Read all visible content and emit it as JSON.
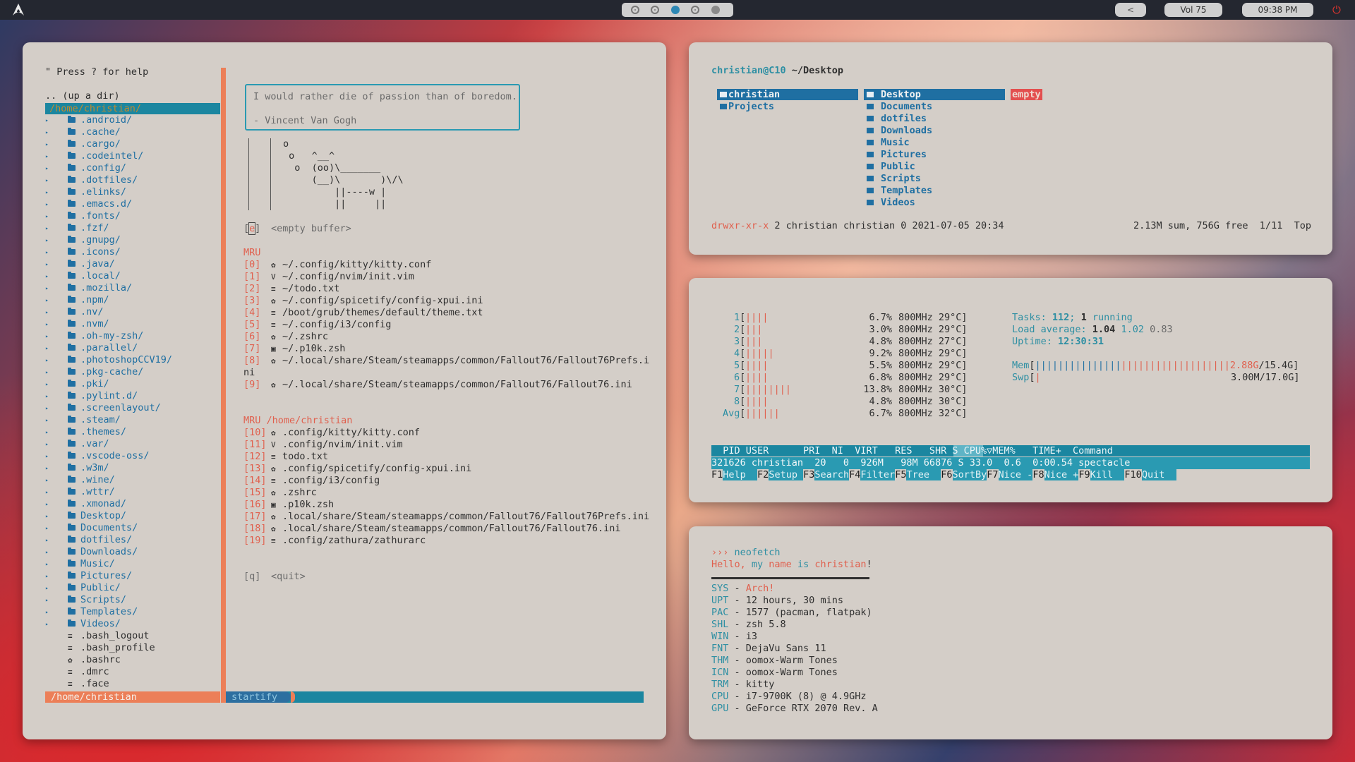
{
  "topbar": {
    "back": "<",
    "volume": "Vol 75",
    "clock": "09:38 PM",
    "workspaces": 5,
    "active_workspace": 3
  },
  "nvim": {
    "help": "\" Press ? for help",
    "up_dir": ".. (up a dir)",
    "cwd_selected": "/home/christian/",
    "tree_dirs": [
      ".android/",
      ".cache/",
      ".cargo/",
      ".codeintel/",
      ".config/",
      ".dotfiles/",
      ".elinks/",
      ".emacs.d/",
      ".fonts/",
      ".fzf/",
      ".gnupg/",
      ".icons/",
      ".java/",
      ".local/",
      ".mozilla/",
      ".npm/",
      ".nv/",
      ".nvm/",
      ".oh-my-zsh/",
      ".parallel/",
      ".photoshopCCV19/",
      ".pkg-cache/",
      ".pki/",
      ".pylint.d/",
      ".screenlayout/",
      ".steam/",
      ".themes/",
      ".var/",
      ".vscode-oss/",
      ".w3m/",
      ".wine/",
      ".wttr/",
      ".xmonad/",
      "Desktop/",
      "Documents/",
      "dotfiles/",
      "Downloads/",
      "Music/",
      "Pictures/",
      "Public/",
      "Scripts/",
      "Templates/",
      "Videos/"
    ],
    "tree_files": [
      {
        "icon": "≡",
        "name": ".bash_logout"
      },
      {
        "icon": "≡",
        "name": ".bash_profile"
      },
      {
        "icon": "✿",
        "name": ".bashrc"
      },
      {
        "icon": "≡",
        "name": ".dmrc"
      },
      {
        "icon": "≡",
        "name": ".face"
      }
    ],
    "tree_status": "/home/christian",
    "quote_line1": "I would rather die of passion than of boredom.",
    "quote_line2": "- Vincent Van Gogh",
    "cow": [
      "o",
      " o   ^__^",
      "  o  (oo)\\_______",
      "     (__)\\       )\\/\\",
      "         ||----w |",
      "         ||     ||"
    ],
    "empty_key": "[e]",
    "empty_label": "<empty buffer>",
    "mru_title": "MRU",
    "mru": [
      {
        "key": "[0]",
        "icon": "✿",
        "path": "~/.config/kitty/kitty.conf"
      },
      {
        "key": "[1]",
        "icon": "V",
        "path": "~/.config/nvim/init.vim"
      },
      {
        "key": "[2]",
        "icon": "≡",
        "path": "~/todo.txt"
      },
      {
        "key": "[3]",
        "icon": "✿",
        "path": "~/.config/spicetify/config-xpui.ini"
      },
      {
        "key": "[4]",
        "icon": "≡",
        "path": "/boot/grub/themes/default/theme.txt"
      },
      {
        "key": "[5]",
        "icon": "≡",
        "path": "~/.config/i3/config"
      },
      {
        "key": "[6]",
        "icon": "✿",
        "path": "~/.zshrc"
      },
      {
        "key": "[7]",
        "icon": "▣",
        "path": "~/.p10k.zsh"
      },
      {
        "key": "[8]",
        "icon": "✿",
        "path": "~/.local/share/Steam/steamapps/common/Fallout76/Fallout76Prefs.i"
      },
      {
        "key": "",
        "icon": "",
        "path": "ni"
      },
      {
        "key": "[9]",
        "icon": "✿",
        "path": "~/.local/share/Steam/steamapps/common/Fallout76/Fallout76.ini"
      }
    ],
    "mru_dir_title": "MRU /home/christian",
    "mru_dir": [
      {
        "key": "[10]",
        "icon": "✿",
        "path": ".config/kitty/kitty.conf"
      },
      {
        "key": "[11]",
        "icon": "V",
        "path": ".config/nvim/init.vim"
      },
      {
        "key": "[12]",
        "icon": "≡",
        "path": "todo.txt"
      },
      {
        "key": "[13]",
        "icon": "✿",
        "path": ".config/spicetify/config-xpui.ini"
      },
      {
        "key": "[14]",
        "icon": "≡",
        "path": ".config/i3/config"
      },
      {
        "key": "[15]",
        "icon": "✿",
        "path": ".zshrc"
      },
      {
        "key": "[16]",
        "icon": "▣",
        "path": ".p10k.zsh"
      },
      {
        "key": "[17]",
        "icon": "✿",
        "path": ".local/share/Steam/steamapps/common/Fallout76/Fallout76Prefs.ini"
      },
      {
        "key": "[18]",
        "icon": "✿",
        "path": ".local/share/Steam/steamapps/common/Fallout76/Fallout76.ini"
      },
      {
        "key": "[19]",
        "icon": "≡",
        "path": ".config/zathura/zathurarc"
      }
    ],
    "quit_key": "[q]",
    "quit_label": "<quit>",
    "startify_status": "startify"
  },
  "ranger": {
    "user_host": "christian@C10",
    "path": " ~/Desktop",
    "col1": [
      "christian",
      "Projects"
    ],
    "col2": [
      "Desktop",
      "Documents",
      "dotfiles",
      "Downloads",
      "Music",
      "Pictures",
      "Public",
      "Scripts",
      "Templates",
      "Videos"
    ],
    "preview": "empty",
    "perms": "drwxr-xr-x",
    "info": " 2 christian christian 0 2021-07-05 20:34",
    "summary": "2.13M sum, 756G free  1/11  Top"
  },
  "htop": {
    "cpus": [
      {
        "n": "1",
        "bars": "||||",
        "pct": "6.7%",
        "freq": "800MHz 29°C]"
      },
      {
        "n": "2",
        "bars": "|||",
        "pct": "3.0%",
        "freq": "800MHz 29°C]"
      },
      {
        "n": "3",
        "bars": "|||",
        "pct": "4.8%",
        "freq": "800MHz 27°C]"
      },
      {
        "n": "4",
        "bars": "|||||",
        "pct": "9.2%",
        "freq": "800MHz 29°C]"
      },
      {
        "n": "5",
        "bars": "||||",
        "pct": "5.5%",
        "freq": "800MHz 29°C]"
      },
      {
        "n": "6",
        "bars": "||||",
        "pct": "6.8%",
        "freq": "800MHz 29°C]"
      },
      {
        "n": "7",
        "bars": "||||||||",
        "pct": "13.8%",
        "freq": "800MHz 30°C]"
      },
      {
        "n": "8",
        "bars": "||||",
        "pct": "4.8%",
        "freq": "800MHz 30°C]"
      }
    ],
    "avg": {
      "label": "Avg",
      "bars": "||||||",
      "pct": "6.7%",
      "freq": "800MHz 32°C]"
    },
    "tasks_label": "Tasks: ",
    "tasks": "112",
    "tasks_sep": "; ",
    "running": "1",
    "running_label": " running",
    "load_label": "Load average: ",
    "load1": "1.04",
    "load5": "1.02",
    "load15": "0.83",
    "uptime_label": "Uptime: ",
    "uptime": "12:30:31",
    "mem_label": "Mem",
    "mem_bars_blue": "|||||||||||||||",
    "mem_bars_red": "|||||||||||||||||||",
    "mem_used": "2.88G",
    "mem_total": "/15.4G]",
    "swp_label": "Swp",
    "swp_bars": "|",
    "swp_val": "3.00M/17.0G]",
    "header": "  PID USER      PRI  NI  VIRT   RES   SHR S CPU%▽MEM%   TIME+  Command",
    "proc": "321626 christian  20   0  926M   98M 66876 S 33.0  0.6  0:00.54 spectacle",
    "fkeys": [
      {
        "k": "F1",
        "l": "Help  "
      },
      {
        "k": "F2",
        "l": "Setup "
      },
      {
        "k": "F3",
        "l": "Search"
      },
      {
        "k": "F4",
        "l": "Filter"
      },
      {
        "k": "F5",
        "l": "Tree  "
      },
      {
        "k": "F6",
        "l": "SortBy"
      },
      {
        "k": "F7",
        "l": "Nice -"
      },
      {
        "k": "F8",
        "l": "Nice +"
      },
      {
        "k": "F9",
        "l": "Kill  "
      },
      {
        "k": "F10",
        "l": "Quit  "
      }
    ]
  },
  "neofetch": {
    "prompt": "›››",
    "cmd": " neofetch",
    "hello_1": "Hello, ",
    "hello_2": "my ",
    "hello_3": "name ",
    "hello_4": "is ",
    "hello_5": "christian",
    "hello_6": "!",
    "rows": [
      {
        "k": "SYS",
        "v": "Arch!"
      },
      {
        "k": "UPT",
        "v": "12 hours, 30 mins"
      },
      {
        "k": "PAC",
        "v": "1577 (pacman, flatpak)"
      },
      {
        "k": "SHL",
        "v": "zsh 5.8"
      },
      {
        "k": "WIN",
        "v": "i3"
      },
      {
        "k": "FNT",
        "v": "DejaVu Sans 11"
      },
      {
        "k": "THM",
        "v": "oomox-Warm Tones"
      },
      {
        "k": "ICN",
        "v": "oomox-Warm Tones"
      },
      {
        "k": "TRM",
        "v": "kitty"
      },
      {
        "k": "CPU",
        "v": "i7-9700K (8) @ 4.9GHz"
      },
      {
        "k": "GPU",
        "v": "GeForce RTX 2070 Rev. A"
      }
    ]
  }
}
